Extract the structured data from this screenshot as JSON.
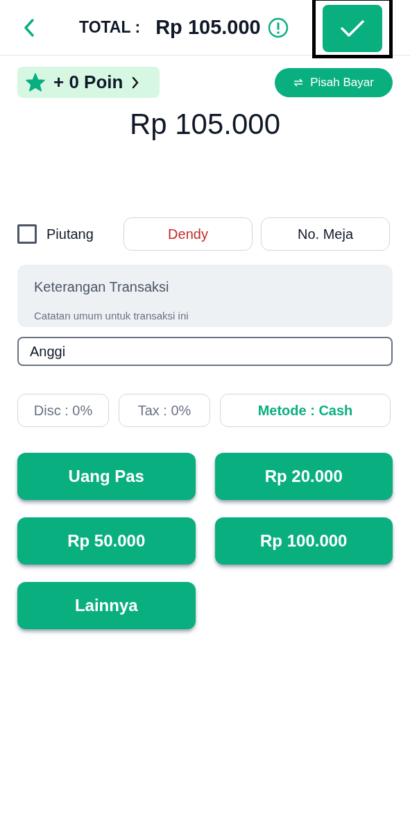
{
  "header": {
    "label": "TOTAL :",
    "total": "Rp 105.000",
    "confirm_highlighted": true
  },
  "points": {
    "label": "+ 0 Poin"
  },
  "split_button": {
    "label": "Pisah Bayar"
  },
  "amount": "Rp 105.000",
  "piutang": {
    "label": "Piutang",
    "checked": false
  },
  "customer_button": {
    "label": "Dendy"
  },
  "table_button": {
    "label": "No. Meja"
  },
  "note": {
    "label": "Keterangan Transaksi",
    "placeholder": "Catatan umum untuk transaksi ini"
  },
  "name_field": {
    "value": "Anggi"
  },
  "options": [
    {
      "label": "Disc : 0%",
      "kind": "plain"
    },
    {
      "label": "Tax : 0%",
      "kind": "plain"
    },
    {
      "label": "Metode : Cash",
      "kind": "accent"
    }
  ],
  "cash_buttons": [
    "Uang Pas",
    "Rp 20.000",
    "Rp 50.000",
    "Rp 100.000",
    "Lainnya"
  ]
}
